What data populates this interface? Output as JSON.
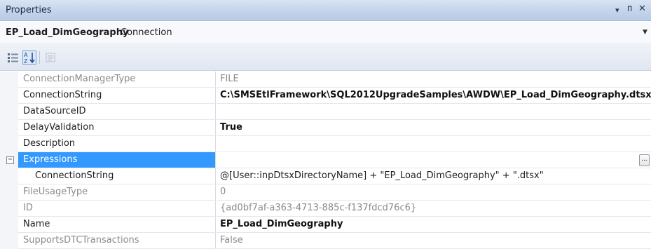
{
  "window": {
    "title": "Properties",
    "dropdown_glyph": "▾",
    "pin_glyph": "ᴨ",
    "close_glyph": "✕"
  },
  "object": {
    "name": "EP_Load_DimGeography",
    "type": "Connection"
  },
  "icons": [
    "categorized-icon",
    "alphabetical-icon",
    "property-pages-icon",
    "collapse-icon",
    "ellipsis-icon"
  ],
  "colors": {
    "selection": "#3399ff",
    "header": "#c3d4ea"
  },
  "properties": [
    {
      "name": "ConnectionManagerType",
      "value": "FILE"
    },
    {
      "name": "ConnectionString",
      "value": "C:\\SMSEtlFramework\\SQL2012UpgradeSamples\\AWDW\\EP_Load_DimGeography.dtsx"
    },
    {
      "name": "DataSourceID",
      "value": ""
    },
    {
      "name": "DelayValidation",
      "value": "True"
    },
    {
      "name": "Description",
      "value": ""
    },
    {
      "name": "Expressions",
      "value": "",
      "expander": "−",
      "button": "..."
    },
    {
      "name": "ConnectionString",
      "value": "@[User::inpDtsxDirectoryName] + \"EP_Load_DimGeography\" + \".dtsx\""
    },
    {
      "name": "FileUsageType",
      "value": "0"
    },
    {
      "name": "ID",
      "value": "{ad0bf7af-a363-4713-885c-f137fdcd76c6}"
    },
    {
      "name": "Name",
      "value": "EP_Load_DimGeography"
    },
    {
      "name": "SupportsDTCTransactions",
      "value": "False"
    }
  ]
}
